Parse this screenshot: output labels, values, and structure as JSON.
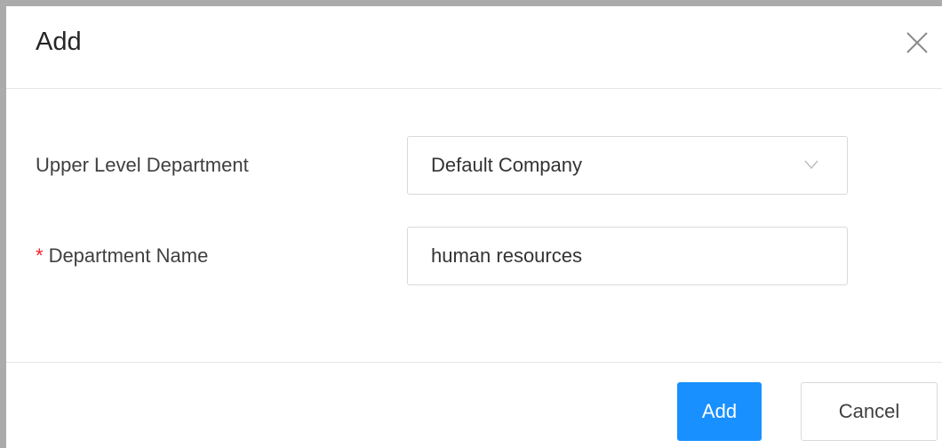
{
  "dialog": {
    "title": "Add",
    "close_icon": "close-icon"
  },
  "form": {
    "upper_level_department": {
      "label": "Upper Level Department",
      "value": "Default Company",
      "icon": "chevron-down-icon"
    },
    "department_name": {
      "required_mark": "*",
      "label": "Department Name",
      "value": "human resources"
    }
  },
  "footer": {
    "add_label": "Add",
    "cancel_label": "Cancel"
  },
  "colors": {
    "primary": "#1890ff",
    "required": "#f5222d",
    "border": "#d9d9d9"
  }
}
